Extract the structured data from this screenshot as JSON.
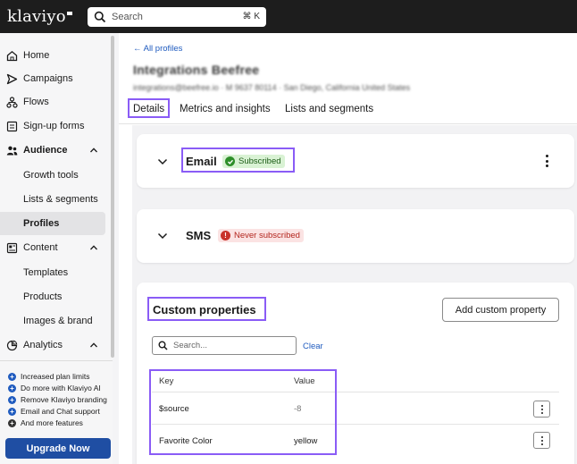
{
  "topbar": {
    "logo_text": "klaviyo",
    "search_placeholder": "Search",
    "search_shortcut": "⌘ K"
  },
  "sidebar": {
    "items": [
      {
        "label": "Home",
        "icon": "home-icon"
      },
      {
        "label": "Campaigns",
        "icon": "send-icon"
      },
      {
        "label": "Flows",
        "icon": "flows-icon"
      },
      {
        "label": "Sign-up forms",
        "icon": "form-icon"
      },
      {
        "label": "Audience",
        "icon": "people-icon",
        "expanded": true
      },
      {
        "label": "Content",
        "icon": "content-icon",
        "expanded": true
      },
      {
        "label": "Analytics",
        "icon": "analytics-icon",
        "expanded": true
      }
    ],
    "audience_sub": [
      "Growth tools",
      "Lists & segments",
      "Profiles"
    ],
    "content_sub": [
      "Templates",
      "Products",
      "Images & brand"
    ],
    "active_item": "Profiles",
    "promo": [
      "Increased plan limits",
      "Do more with Klaviyo AI",
      "Remove Klaviyo branding",
      "Email and Chat support",
      "And more features"
    ],
    "upgrade_label": "Upgrade Now"
  },
  "profile": {
    "back_link": "← All profiles",
    "name": "Integrations Beefree",
    "meta": "integrations@beefree.io · M 9637 80114 · San Diego, California United States"
  },
  "tabs": [
    "Details",
    "Metrics and insights",
    "Lists and segments"
  ],
  "active_tab": "Details",
  "email_card": {
    "label": "Email",
    "status": "Subscribed",
    "status_color": "#2e8f2a"
  },
  "sms_card": {
    "label": "SMS",
    "status": "Never subscribed",
    "status_color": "#c8322a"
  },
  "custom_properties": {
    "title": "Custom properties",
    "add_button": "Add custom property",
    "search_placeholder": "Search...",
    "clear_label": "Clear",
    "headers": {
      "key": "Key",
      "value": "Value"
    },
    "rows": [
      {
        "key": "$source",
        "value": "-8"
      },
      {
        "key": "Favorite Color",
        "value": "yellow"
      }
    ]
  },
  "colors": {
    "accent": "#1f5bbf",
    "highlight": "#8a5cf6",
    "upgrade": "#1f4ea3"
  }
}
